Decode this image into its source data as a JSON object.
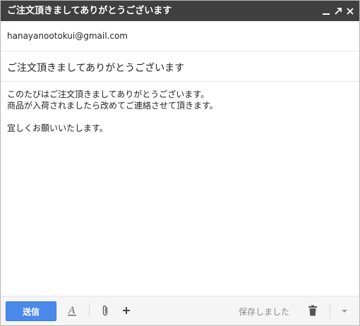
{
  "window": {
    "title": "ご注文頂きましてありがとうございます",
    "controls": [
      "minimize-icon",
      "expand-icon",
      "close-icon"
    ]
  },
  "to": {
    "value": "hanayanootokui@gmail.com"
  },
  "subject": {
    "value": "ご注文頂きましてありがとうございます"
  },
  "body": {
    "lines": [
      "このたびはご注文頂きましてありがとうございます。",
      "商品が入荷されましたら改めてご連絡させて頂きます。",
      "宜しくお願いいたします。"
    ]
  },
  "toolbar": {
    "send_label": "送信",
    "saved_status": "保存しました",
    "icons": [
      "format-text-icon",
      "paperclip-icon",
      "plus-icon",
      "trash-icon",
      "chevron-down-icon"
    ],
    "send_color": "#4a89ea"
  },
  "colors": {
    "titlebar": "#404040",
    "send_button": "#4a89ea"
  }
}
